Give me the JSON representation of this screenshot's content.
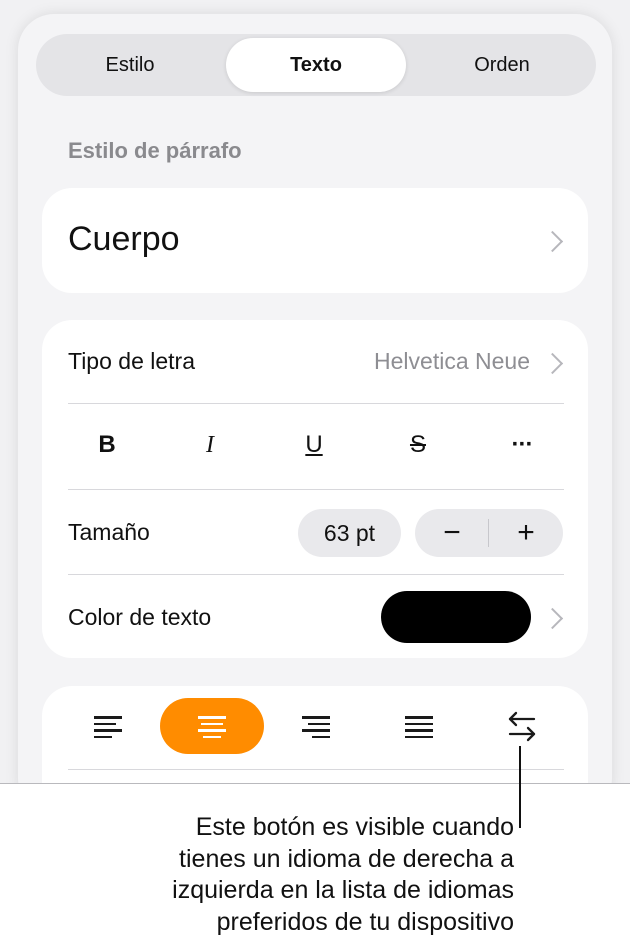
{
  "tabs": [
    {
      "label": "Estilo",
      "active": false
    },
    {
      "label": "Texto",
      "active": true
    },
    {
      "label": "Orden",
      "active": false
    }
  ],
  "paragraph_style": {
    "section_label": "Estilo de párrafo",
    "value": "Cuerpo"
  },
  "font": {
    "label": "Tipo de letra",
    "value": "Helvetica Neue",
    "format_buttons": [
      {
        "name": "bold",
        "glyph": "B"
      },
      {
        "name": "italic",
        "glyph": "I"
      },
      {
        "name": "underline",
        "glyph": "U"
      },
      {
        "name": "strikethrough",
        "glyph": "S"
      },
      {
        "name": "more",
        "glyph": "···"
      }
    ],
    "size_label": "Tamaño",
    "size_value": "63 pt",
    "decrement_glyph": "−",
    "increment_glyph": "+",
    "color_label": "Color de texto",
    "color_value": "#000000"
  },
  "alignment": {
    "options": [
      "align-left",
      "align-center",
      "align-right",
      "align-justify",
      "text-direction"
    ],
    "selected": "align-center",
    "accent_color": "#ff8c00"
  },
  "callout": {
    "lines": [
      "Este botón es visible cuando",
      "tienes un idioma de derecha a",
      "izquierda en la lista de idiomas",
      "preferidos de tu dispositivo"
    ]
  }
}
